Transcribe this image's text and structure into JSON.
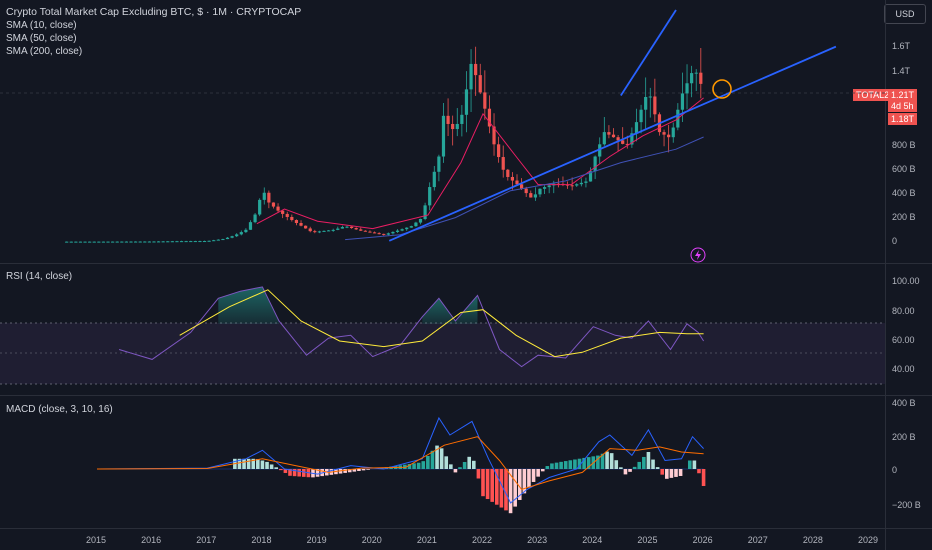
{
  "header": {
    "title": "Crypto Total Market Cap Excluding BTC, $ · 1M · CRYPTOCAP",
    "indicators": [
      "SMA (10, close)",
      "SMA (50, close)",
      "SMA (200, close)"
    ],
    "currency_button": "USD"
  },
  "price_axis": {
    "ticks": [
      "1.6T",
      "1.4T",
      "800 B",
      "600 B",
      "400 B",
      "200 B",
      "0"
    ],
    "symbol_tag": "TOTAL2",
    "last_price": "1.21T",
    "countdown": "4d 5h",
    "sma_price": "1.18T"
  },
  "rsi_pane": {
    "title": "RSI (14, close)",
    "ticks": [
      "100.00",
      "80.00",
      "60.00",
      "40.00"
    ]
  },
  "macd_pane": {
    "title": "MACD (close, 3, 10, 16)",
    "ticks": [
      "400 B",
      "200 B",
      "0",
      "−200 B"
    ]
  },
  "time_axis": {
    "ticks": [
      "2015",
      "2016",
      "2017",
      "2018",
      "2019",
      "2020",
      "2021",
      "2022",
      "2023",
      "2024",
      "2025",
      "2026",
      "2027",
      "2028",
      "2029"
    ]
  },
  "colors": {
    "background": "#131722",
    "up": "#26a69a",
    "down": "#ef5350",
    "trendline": "#2962ff",
    "rsi_line": "#7e57c2",
    "rsi_ma": "#ffeb3b",
    "macd_line": "#2962ff",
    "signal_line": "#ff6d00",
    "highlight_circle": "#ff9800"
  },
  "chart_data": {
    "type": "candlestick",
    "title": "Crypto Total Market Cap Excluding BTC, $ · 1M · CRYPTOCAP",
    "x_unit": "year",
    "y_unit": "USD billions",
    "ylim": [
      -20,
      1900
    ],
    "xlim": [
      2014.4,
      2029.6
    ],
    "monthly_closes_approx": [
      [
        2015.0,
        3
      ],
      [
        2016.0,
        4
      ],
      [
        2016.5,
        7
      ],
      [
        2017.0,
        8
      ],
      [
        2017.3,
        25
      ],
      [
        2017.5,
        55
      ],
      [
        2017.7,
        100
      ],
      [
        2017.9,
        250
      ],
      [
        2018.0,
        440
      ],
      [
        2018.1,
        330
      ],
      [
        2018.3,
        250
      ],
      [
        2018.6,
        160
      ],
      [
        2018.9,
        80
      ],
      [
        2019.3,
        100
      ],
      [
        2019.5,
        130
      ],
      [
        2019.8,
        90
      ],
      [
        2020.0,
        75
      ],
      [
        2020.2,
        60
      ],
      [
        2020.5,
        100
      ],
      [
        2020.7,
        130
      ],
      [
        2020.9,
        200
      ],
      [
        2021.0,
        400
      ],
      [
        2021.2,
        700
      ],
      [
        2021.3,
        1100
      ],
      [
        2021.4,
        900
      ],
      [
        2021.6,
        1000
      ],
      [
        2021.8,
        1500
      ],
      [
        2021.9,
        1300
      ],
      [
        2022.0,
        1150
      ],
      [
        2022.2,
        800
      ],
      [
        2022.4,
        550
      ],
      [
        2022.6,
        480
      ],
      [
        2022.9,
        350
      ],
      [
        2023.0,
        430
      ],
      [
        2023.3,
        480
      ],
      [
        2023.6,
        460
      ],
      [
        2023.9,
        500
      ],
      [
        2024.0,
        660
      ],
      [
        2024.2,
        900
      ],
      [
        2024.4,
        850
      ],
      [
        2024.6,
        780
      ],
      [
        2024.8,
        1000
      ],
      [
        2025.0,
        1250
      ],
      [
        2025.2,
        900
      ],
      [
        2025.4,
        850
      ],
      [
        2025.6,
        1200
      ],
      [
        2025.8,
        1400
      ],
      [
        2025.9,
        1380
      ],
      [
        2026.0,
        1210
      ]
    ],
    "last_value": "1.21T",
    "sma10": [
      [
        2017.9,
        150
      ],
      [
        2018.4,
        270
      ],
      [
        2019.0,
        170
      ],
      [
        2020.0,
        110
      ],
      [
        2021.0,
        220
      ],
      [
        2021.6,
        650
      ],
      [
        2022.0,
        1050
      ],
      [
        2022.6,
        700
      ],
      [
        2023.0,
        470
      ],
      [
        2023.6,
        470
      ],
      [
        2024.3,
        700
      ],
      [
        2024.9,
        870
      ],
      [
        2025.5,
        1000
      ],
      [
        2026.0,
        1180
      ]
    ],
    "sma50": [
      [
        2019.5,
        20
      ],
      [
        2020.5,
        60
      ],
      [
        2021.5,
        200
      ],
      [
        2022.5,
        420
      ],
      [
        2023.5,
        500
      ],
      [
        2024.5,
        650
      ],
      [
        2025.5,
        760
      ],
      [
        2026.0,
        860
      ]
    ],
    "trendlines": [
      {
        "from": [
          2020.3,
          10
        ],
        "to": [
          2028.4,
          1600
        ]
      },
      {
        "from": [
          2024.5,
          1200
        ],
        "to": [
          2025.5,
          1900
        ]
      }
    ],
    "rsi": {
      "ylim": [
        20,
        110
      ],
      "levels": [
        70,
        50,
        30
      ],
      "values": [
        [
          2015.4,
          52
        ],
        [
          2016.0,
          45
        ],
        [
          2016.7,
          64
        ],
        [
          2017.2,
          88
        ],
        [
          2017.6,
          93
        ],
        [
          2018.0,
          96
        ],
        [
          2018.3,
          72
        ],
        [
          2018.8,
          48
        ],
        [
          2019.2,
          60
        ],
        [
          2019.6,
          62
        ],
        [
          2020.0,
          47
        ],
        [
          2020.5,
          55
        ],
        [
          2020.9,
          75
        ],
        [
          2021.2,
          88
        ],
        [
          2021.5,
          72
        ],
        [
          2021.9,
          90
        ],
        [
          2022.3,
          52
        ],
        [
          2022.7,
          40
        ],
        [
          2023.0,
          48
        ],
        [
          2023.5,
          46
        ],
        [
          2024.0,
          68
        ],
        [
          2024.4,
          62
        ],
        [
          2024.7,
          60
        ],
        [
          2025.0,
          72
        ],
        [
          2025.4,
          52
        ],
        [
          2025.7,
          70
        ],
        [
          2025.9,
          64
        ],
        [
          2026.0,
          58
        ]
      ],
      "ma": [
        [
          2016.5,
          62
        ],
        [
          2017.4,
          82
        ],
        [
          2018.1,
          94
        ],
        [
          2018.7,
          72
        ],
        [
          2019.4,
          58
        ],
        [
          2020.2,
          54
        ],
        [
          2020.9,
          58
        ],
        [
          2021.6,
          78
        ],
        [
          2022.0,
          80
        ],
        [
          2022.6,
          62
        ],
        [
          2023.3,
          47
        ],
        [
          2023.8,
          50
        ],
        [
          2024.5,
          60
        ],
        [
          2025.2,
          64
        ],
        [
          2025.7,
          63
        ],
        [
          2026.0,
          63
        ]
      ]
    },
    "macd": {
      "ylim": [
        -260,
        420
      ],
      "macd_line": [
        [
          2015.0,
          0
        ],
        [
          2017.0,
          5
        ],
        [
          2017.7,
          60
        ],
        [
          2018.0,
          110
        ],
        [
          2018.4,
          0
        ],
        [
          2019.0,
          -30
        ],
        [
          2019.6,
          20
        ],
        [
          2020.2,
          0
        ],
        [
          2020.9,
          60
        ],
        [
          2021.2,
          300
        ],
        [
          2021.4,
          200
        ],
        [
          2021.8,
          280
        ],
        [
          2022.1,
          60
        ],
        [
          2022.5,
          -200
        ],
        [
          2022.8,
          -120
        ],
        [
          2023.2,
          -50
        ],
        [
          2023.7,
          0
        ],
        [
          2024.1,
          160
        ],
        [
          2024.3,
          200
        ],
        [
          2024.7,
          80
        ],
        [
          2025.0,
          230
        ],
        [
          2025.3,
          50
        ],
        [
          2025.6,
          60
        ],
        [
          2025.8,
          190
        ],
        [
          2026.0,
          120
        ]
      ],
      "signal_line": [
        [
          2015.0,
          0
        ],
        [
          2017.0,
          3
        ],
        [
          2018.0,
          60
        ],
        [
          2018.6,
          20
        ],
        [
          2019.2,
          -20
        ],
        [
          2019.8,
          5
        ],
        [
          2020.6,
          10
        ],
        [
          2021.3,
          140
        ],
        [
          2021.9,
          190
        ],
        [
          2022.3,
          50
        ],
        [
          2022.7,
          -120
        ],
        [
          2023.2,
          -70
        ],
        [
          2023.8,
          -20
        ],
        [
          2024.3,
          120
        ],
        [
          2024.8,
          110
        ],
        [
          2025.2,
          130
        ],
        [
          2025.6,
          100
        ],
        [
          2026.0,
          90
        ]
      ],
      "histogram_approx": [
        [
          2017.9,
          60
        ],
        [
          2018.1,
          40
        ],
        [
          2018.5,
          -40
        ],
        [
          2018.9,
          -50
        ],
        [
          2020.9,
          40
        ],
        [
          2021.2,
          150
        ],
        [
          2021.5,
          -20
        ],
        [
          2021.8,
          90
        ],
        [
          2022.0,
          -160
        ],
        [
          2022.3,
          -220
        ],
        [
          2022.5,
          -260
        ],
        [
          2022.8,
          -120
        ],
        [
          2023.2,
          30
        ],
        [
          2024.1,
          80
        ],
        [
          2024.3,
          110
        ],
        [
          2024.6,
          -40
        ],
        [
          2025.0,
          100
        ],
        [
          2025.3,
          -60
        ],
        [
          2025.6,
          -40
        ],
        [
          2025.8,
          80
        ],
        [
          2026.0,
          -100
        ]
      ]
    }
  }
}
